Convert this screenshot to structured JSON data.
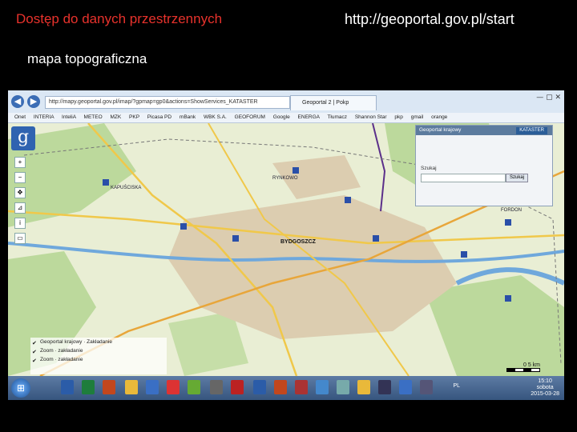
{
  "slide": {
    "title": "Dostęp do danych przestrzennych",
    "url": "http://geoportal.gov.pl/start",
    "subtitle": "mapa topograficzna"
  },
  "browser": {
    "address": "http://mapy.geoportal.gov.pl/imap/?gpmap=gp0&actions=ShowServices_KATASTER",
    "tab_label": "Geoportal 2 | Pokp",
    "favorites": [
      "Onet",
      "INTERIA",
      "InteliA",
      "METEO",
      "MZK",
      "PKP",
      "Picasa PD",
      "mBank",
      "WBK S.A.",
      "GEOFORUM",
      "Google",
      "ENERGA",
      "Tłumacz",
      "Shannon Star",
      "pkp",
      "gmail",
      "orange"
    ]
  },
  "map": {
    "places": [
      "BYDGOSZCZ",
      "RYNKOWO",
      "KAPUŚCISKA",
      "FORDON"
    ],
    "panel": {
      "title": "Geoportal krajowy",
      "tab": "KATASTER",
      "label": "Szukaj",
      "button": "Szukaj"
    },
    "layers": [
      {
        "label": "Geoportal krajowy · Zakładanie",
        "checked": true
      },
      {
        "label": "Zoom · zakładanie",
        "checked": true
      },
      {
        "label": "Zoom · zakładanie",
        "checked": true
      }
    ],
    "scale_label": "0   5 km"
  },
  "taskbar": {
    "start_glyph": "⊞",
    "lang": "PL",
    "time": "15:10",
    "day": "sobota",
    "date": "2015-03-28"
  },
  "colors": {
    "title_red": "#e8322c",
    "urban": "#d9c8a8",
    "forest": "#b9d89a",
    "water": "#7fb3e0",
    "road": "#f0c84a"
  }
}
